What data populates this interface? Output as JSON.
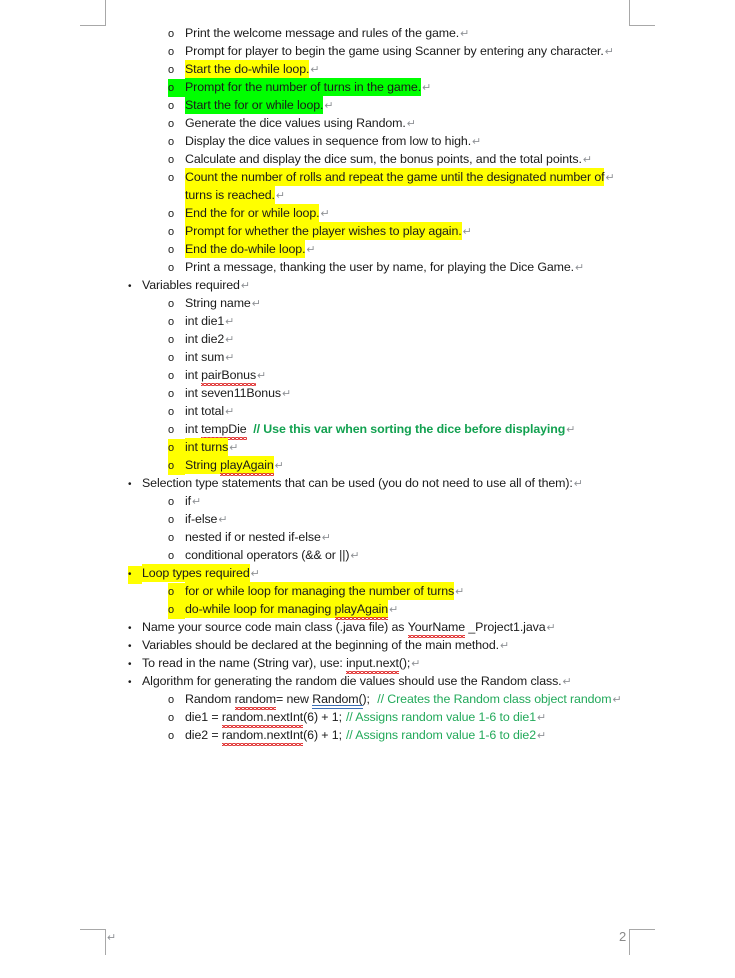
{
  "document": {
    "page_number": "2",
    "footer_paragraph_mark": "↵",
    "paragraph_mark": "↵",
    "bullet_marker": "•",
    "circle_marker": "o",
    "highlight_yellow": "#ffff00",
    "highlight_green": "#00ff00",
    "comment_color": "#12a150"
  },
  "lines": [
    {
      "id": "l1",
      "level": 2,
      "text": "Print the welcome message and rules of the game.",
      "highlight": "none"
    },
    {
      "id": "l2",
      "level": 2,
      "text": "Prompt for player to begin the game using Scanner by entering any character.",
      "highlight": "none"
    },
    {
      "id": "l3",
      "level": 2,
      "text": "Start the do-while loop.",
      "highlight": "yellow"
    },
    {
      "id": "l4",
      "level": 2,
      "text": "Prompt for the number of turns in the game.",
      "highlight": "green-full"
    },
    {
      "id": "l5",
      "level": 2,
      "text": "Start the for or while loop.",
      "highlight": "green"
    },
    {
      "id": "l6",
      "level": 2,
      "text": "Generate the dice values using Random.",
      "highlight": "none"
    },
    {
      "id": "l7",
      "level": 2,
      "text": "Display the dice values in sequence from low to high.",
      "highlight": "none"
    },
    {
      "id": "l8",
      "level": 2,
      "text": "Calculate and display the dice sum, the bonus points, and the total points.",
      "highlight": "none"
    },
    {
      "id": "l9",
      "level": 2,
      "text": "Count the number of rolls and repeat the game until the designated number of",
      "highlight": "yellow",
      "no_pilcrow": true
    },
    {
      "id": "l10",
      "level": "cont",
      "text": "turns is reached.",
      "highlight": "yellow"
    },
    {
      "id": "l11",
      "level": 2,
      "text": "End the for or while loop.",
      "highlight": "yellow"
    },
    {
      "id": "l12",
      "level": 2,
      "text": "Prompt for whether the player wishes to play again.",
      "highlight": "yellow"
    },
    {
      "id": "l13",
      "level": 2,
      "text": "End the do-while loop.",
      "highlight": "yellow"
    },
    {
      "id": "l14",
      "level": 2,
      "text": "Print a message, thanking the user by name, for playing the Dice Game.",
      "highlight": "none"
    },
    {
      "id": "l15",
      "level": 1,
      "text": "Variables required",
      "highlight": "none"
    },
    {
      "id": "l16",
      "level": 2,
      "text": "String name",
      "highlight": "none"
    },
    {
      "id": "l17",
      "level": 2,
      "text": "int die1",
      "highlight": "none"
    },
    {
      "id": "l18",
      "level": 2,
      "text": "int die2",
      "highlight": "none"
    },
    {
      "id": "l19",
      "level": 2,
      "text": "int sum",
      "highlight": "none"
    },
    {
      "id": "l20",
      "level": 2,
      "text_pre": "int ",
      "text_sp": "pairBonus",
      "highlight": "none"
    },
    {
      "id": "l21",
      "level": 2,
      "text": "int seven11Bonus",
      "highlight": "none"
    },
    {
      "id": "l22",
      "level": 2,
      "text": "int total",
      "highlight": "none"
    },
    {
      "id": "l23",
      "level": 2,
      "text_pre": "int ",
      "text_sp": "tempDie",
      "comment": "// Use this var when sorting the dice before displaying",
      "highlight": "none"
    },
    {
      "id": "l24",
      "level": 2,
      "text": "int turns",
      "highlight": "yellow-full"
    },
    {
      "id": "l25",
      "level": 2,
      "text_pre": "String ",
      "text_sp": "playAgain",
      "highlight": "yellow-full"
    },
    {
      "id": "l26",
      "level": 1,
      "text": "Selection type statements that can be used (you do not need to use all of them):",
      "highlight": "none"
    },
    {
      "id": "l27",
      "level": 2,
      "text": "if",
      "highlight": "none"
    },
    {
      "id": "l28",
      "level": 2,
      "text": "if-else",
      "highlight": "none"
    },
    {
      "id": "l29",
      "level": 2,
      "text": "nested if or nested if-else",
      "highlight": "none"
    },
    {
      "id": "l30",
      "level": 2,
      "text": "conditional operators (&& or ||)",
      "highlight": "none"
    },
    {
      "id": "l31",
      "level": 1,
      "text": "Loop types required",
      "highlight": "yellow-full"
    },
    {
      "id": "l32",
      "level": 2,
      "text": "for or while loop for managing the number of turns",
      "highlight": "yellow-full"
    },
    {
      "id": "l33",
      "level": 2,
      "text_pre": "do-while loop for managing ",
      "text_sp": "playAgain",
      "highlight": "yellow-full"
    },
    {
      "id": "l34",
      "level": 1,
      "text_pre": "Name your source code main class (.java file) as ",
      "text_sp": "YourName",
      "text_post": " _Project1.java",
      "highlight": "none"
    },
    {
      "id": "l35",
      "level": 1,
      "text": "Variables should be declared at the beginning of the main method.",
      "highlight": "none"
    },
    {
      "id": "l36",
      "level": 1,
      "text_pre": "To read in the name (String var), use:  ",
      "text_sp": "input.next",
      "text_post": "(); ",
      "highlight": "none"
    },
    {
      "id": "l37",
      "level": 1,
      "text": "Algorithm for generating the random die values should use the Random class.",
      "highlight": "none"
    },
    {
      "id": "l38",
      "level": 2,
      "code_pre": "Random ",
      "code_sp": "random ",
      "code_mid": "= new ",
      "code_gr": "Random(",
      "code_post": "); ",
      "comment_plain": "// Creates the Random class object random",
      "highlight": "none"
    },
    {
      "id": "l39",
      "level": 2,
      "code_pre": "die1 = ",
      "code_sp": "random.nextInt",
      "code_post": "(6) + 1;",
      "comment_plain": "// Assigns random value 1-6 to die1",
      "highlight": "none"
    },
    {
      "id": "l40",
      "level": 2,
      "code_pre": "die2 = ",
      "code_sp": "random.nextInt",
      "code_post": "(6) + 1;",
      "comment_plain": "// Assigns random value 1-6 to die2",
      "highlight": "none"
    }
  ]
}
